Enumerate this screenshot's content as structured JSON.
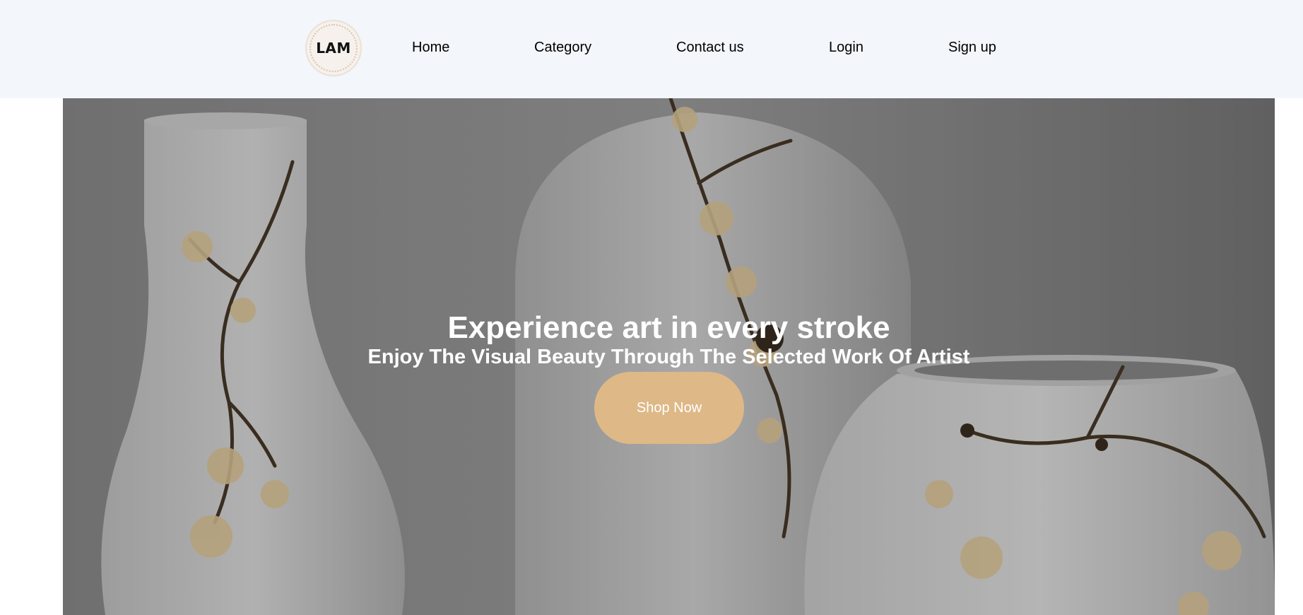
{
  "header": {
    "logo": {
      "text": "LAM",
      "icon": "lam-logo-badge"
    },
    "nav": [
      {
        "label": "Home"
      },
      {
        "label": "Category"
      },
      {
        "label": "Contact us"
      },
      {
        "label": "Login"
      },
      {
        "label": "Sign up"
      }
    ]
  },
  "hero": {
    "title": "Experience art in every stroke",
    "subtitle": "Enjoy The Visual Beauty Through The Selected Work Of Artist",
    "cta_label": "Shop Now",
    "image": "vases-with-blossom-branches"
  },
  "colors": {
    "header_bg": "#f3f6fb",
    "cta_bg": "#deb887",
    "hero_text": "#ffffff"
  }
}
